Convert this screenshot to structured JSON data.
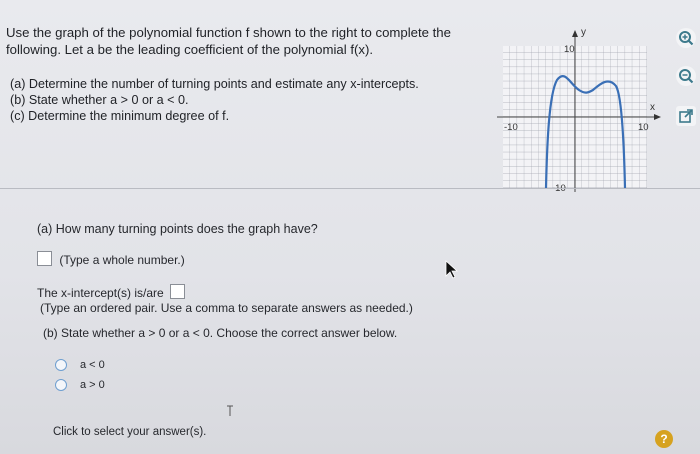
{
  "problem": {
    "line1": "Use the graph of the polynomial function f shown to the right to complete the",
    "line2": "following. Let a be the leading coefficient of the polynomial f(x).",
    "part_a": "(a) Determine the number of turning points and estimate any x-intercepts.",
    "part_b": "(b) State whether a > 0 or a < 0.",
    "part_c": "(c) Determine the minimum degree of f."
  },
  "graph": {
    "y_label": "y",
    "x_label": "x",
    "y_tick_top": "10",
    "y_tick_bottom": "-10",
    "x_tick_left": "-10",
    "x_tick_right": "10"
  },
  "questions": {
    "turning_prompt": "(a) How many turning points does the graph have?",
    "turning_hint": "(Type a whole number.)",
    "intercepts_prompt": "The x-intercept(s) is/are",
    "intercepts_hint": "(Type an ordered pair. Use a comma to separate answers as needed.)",
    "part_b_prompt": "(b) State whether a > 0 or a < 0. Choose the correct answer below.",
    "option_1": "a < 0",
    "option_2": "a > 0",
    "footer": "Click to select your answer(s)."
  },
  "icons": [
    "zoom-in-icon",
    "zoom-out-icon",
    "external-link-icon",
    "help-icon"
  ],
  "colors": {
    "curve": "#3a6fb6",
    "radio": "#6f9fd0",
    "help": "#d6a21f"
  }
}
